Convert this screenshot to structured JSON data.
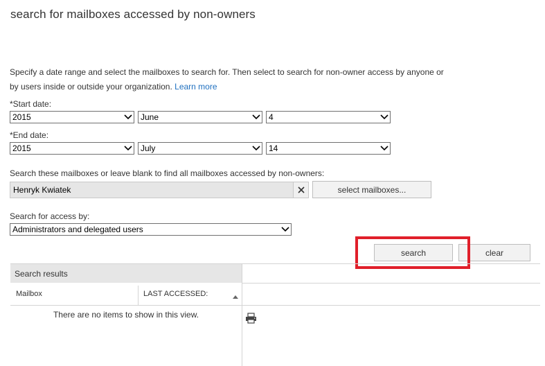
{
  "page": {
    "title": "search for mailboxes accessed by non-owners",
    "description_line1": "Specify a date range and select the mailboxes to search for. Then select to search for non-owner access by anyone or",
    "description_line2": "by users inside or outside your organization.",
    "learn_more": "Learn more"
  },
  "start_date": {
    "label": "*Start date:",
    "year": "2015",
    "month": "June",
    "day": "4"
  },
  "end_date": {
    "label": "*End date:",
    "year": "2015",
    "month": "July",
    "day": "14"
  },
  "mailboxes": {
    "label": "Search these mailboxes or leave blank to find all mailboxes accessed by non-owners:",
    "selected": "Henryk Kwiatek",
    "select_button": "select mailboxes..."
  },
  "access": {
    "label": "Search for access by:",
    "selected": "Administrators and delegated users"
  },
  "buttons": {
    "search": "search",
    "clear": "clear"
  },
  "results": {
    "header": "Search results",
    "columns": [
      "Mailbox",
      "LAST ACCESSED:"
    ],
    "empty_text": "There are no items to show in this view."
  },
  "colors": {
    "highlight": "#e01f2a",
    "link": "#1e6fbf"
  }
}
